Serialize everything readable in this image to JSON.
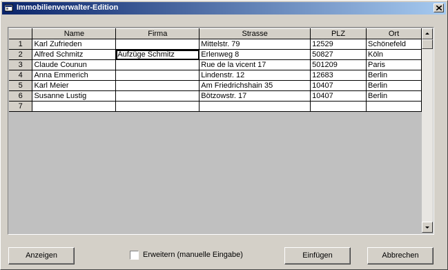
{
  "window": {
    "title": "Immobilienverwalter-Edition"
  },
  "grid": {
    "columns": [
      "",
      "Name",
      "Firma",
      "Strasse",
      "PLZ",
      "Ort"
    ],
    "rows": [
      {
        "num": "1",
        "name": "Karl Zufrieden",
        "firma": "",
        "strasse": "Mittelstr. 79",
        "plz": "12529",
        "ort": "Schönefeld"
      },
      {
        "num": "2",
        "name": "Alfred Schmitz",
        "firma": "Aufzüge Schmitz",
        "strasse": "Erlenweg 8",
        "plz": "50827",
        "ort": "Köln"
      },
      {
        "num": "3",
        "name": "Claude Counun",
        "firma": "",
        "strasse": "Rue de la vicent 17",
        "plz": "501209",
        "ort": "Paris"
      },
      {
        "num": "4",
        "name": "Anna Emmerich",
        "firma": "",
        "strasse": "Lindenstr. 12",
        "plz": "12683",
        "ort": "Berlin"
      },
      {
        "num": "5",
        "name": "Karl Meier",
        "firma": "",
        "strasse": "Am Friedrichshain 35",
        "plz": "10407",
        "ort": "Berlin"
      },
      {
        "num": "6",
        "name": "Susanne Lustig",
        "firma": "",
        "strasse": "Bötzowstr. 17",
        "plz": "10407",
        "ort": "Berlin"
      },
      {
        "num": "7",
        "name": "",
        "firma": "",
        "strasse": "",
        "plz": "",
        "ort": ""
      }
    ]
  },
  "buttons": {
    "anzeigen": "Anzeigen",
    "einfuegen": "Einfügen",
    "abbrechen": "Abbrechen"
  },
  "checkbox": {
    "label": "Erweitern (manuelle Eingabe)",
    "checked": false
  },
  "icons": {
    "app": "app-icon",
    "close": "close-icon",
    "scroll_up": "arrow-up-icon",
    "scroll_down": "arrow-down-icon"
  }
}
